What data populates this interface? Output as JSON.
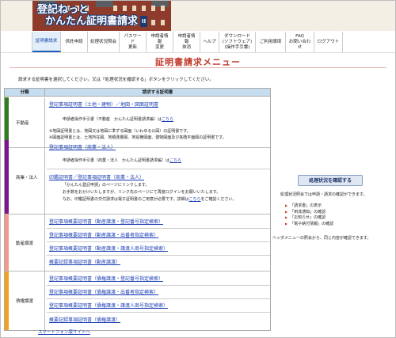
{
  "header": {
    "logo_line1": "登記ねっと",
    "logo_line2": "かんたん証明書請求",
    "logo_badge": "II"
  },
  "nav": [
    {
      "label": "証明書請求",
      "active": true
    },
    {
      "label": "供託申請",
      "active": false
    },
    {
      "label": "処理状況照会",
      "active": false
    },
    {
      "label": "パスワード\n更新",
      "active": false
    },
    {
      "label": "申請者情報\n変更",
      "active": false
    },
    {
      "label": "申請者情報\n抹消",
      "active": false
    },
    {
      "label": "ヘルプ",
      "active": false
    },
    {
      "label": "ダウンロード\n(ソフトウェア)\n(操作手引書)",
      "active": false
    },
    {
      "label": "ご利用環境",
      "active": false
    },
    {
      "label": "FAQ\nお問い合わせ",
      "active": false
    },
    {
      "label": "ログアウト",
      "active": false
    }
  ],
  "page_title": "証明書請求メニュー",
  "instructions": "請求する証明書を選択してください。又は「処理状況を確認する」ボタンをクリックしてください。",
  "table": {
    "head_category": "分類",
    "head_certificate": "請求する証明書",
    "fudosan": {
      "category": "不動産",
      "color": "#2e7d1e",
      "link": "登記事項証明書（土地・建物）／地図・図面証明書",
      "guide_prefix": "申請者操作手引書（不動産　かんたん証明書請求編）は",
      "guide_link": "こちら",
      "note1": "※地図証明書とは、地図又は地図に準ずる図面（いわゆる公図）の証明書です。",
      "note2": "※図面証明書とは、土地所在図、地積測量図、地役権図面、建物図面及び各階平面図の証明書です。"
    },
    "shogyo": {
      "category": "商業・法人",
      "color": "#7d1590",
      "link1": "登記事項証明書（商業・法人）",
      "guide_prefix": "申請者操作手引書（商業・法人　かんたん証明書請求編）は",
      "guide_link": "こちら",
      "link2": "印鑑証明書／登記事項証明書（商業・法人）",
      "line1": "「かんたん登記申請」のページにリンクします。",
      "line2": "お手数をおかけいたしますが、リンク先のページにて再度ログインをお願いいたします。",
      "line3_prefix": "なお、印鑑証明書の交付請求は電子証明書のご用意が必要です。詳細は",
      "line3_link": "こちら",
      "line3_suffix": "をご確認ください。"
    },
    "dosan": {
      "category": "動産譲渡",
      "color": "#f19a8c",
      "links": [
        "登記事項概要証明書（動産譲渡・登記番号指定検索）",
        "登記事項概要証明書（動産譲渡・出番者指定検索）",
        "登記事項概要証明書（動産譲渡・譲渡人商号指定検索）",
        "概要記録事項証明書（動産譲渡）"
      ]
    },
    "saiken": {
      "category": "債権譲渡",
      "color": "#f2a11f",
      "links": [
        "登記事項概要証明書（債権譲渡・登記番号指定検索）",
        "登記事項概要証明書（債権譲渡・出番者指定検索）",
        "登記事項概要証明書（債権譲渡・譲渡人商号指定検索）",
        "概要記録事項証明書（債権譲渡）"
      ]
    }
  },
  "smartphone_link": "スマートフォン版サイトへ",
  "right": {
    "button": "処理状況を確認する",
    "note": "処理状況照会では申請・請求の確認ができます。",
    "list": [
      "「請求書」の表示",
      "「到達通知」の確認",
      "「お知らせ」の確認",
      "「電子納付情報」の確認"
    ],
    "footer": "ヘッダメニューの照会から、同じ内容が確認できます。"
  }
}
